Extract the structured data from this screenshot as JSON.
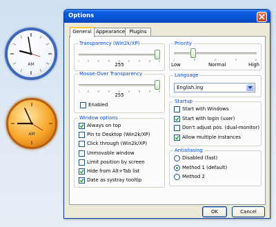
{
  "clocks": {
    "am_label": "AM"
  },
  "window": {
    "title": "Options",
    "tabs": [
      {
        "label": "General",
        "active": true
      },
      {
        "label": "Appearance",
        "active": false
      },
      {
        "label": "Plugins",
        "active": false
      }
    ],
    "transparency": {
      "title": "Transparency (Win2k/XP)",
      "value": "255",
      "level": 1.0
    },
    "mouseover": {
      "title": "Mouse-Over Transparency",
      "value": "255",
      "level": 1.0,
      "enabled_label": "Enabled",
      "enabled_checked": false
    },
    "window_options": {
      "title": "Window options",
      "items": [
        {
          "label": "Always on top",
          "checked": true
        },
        {
          "label": "Pin to Desktop (Win2k/XP)",
          "checked": false
        },
        {
          "label": "Click through (Win2k/XP)",
          "checked": false
        },
        {
          "label": "Unmovable window",
          "checked": false
        },
        {
          "label": "Limit position by screen",
          "checked": false
        },
        {
          "label": "Hide from Alt+Tab list",
          "checked": true
        },
        {
          "label": "Date as systray tooltip",
          "checked": true
        }
      ]
    },
    "priority": {
      "title": "Priority",
      "low": "Low",
      "normal": "Normal",
      "high": "High",
      "level": 0.2
    },
    "language": {
      "title": "Language",
      "selected": "English.ing"
    },
    "startup": {
      "title": "Startup",
      "items": [
        {
          "label": "Start with Windows",
          "checked": false
        },
        {
          "label": "Start with login (user)",
          "checked": true
        },
        {
          "label": "Don't adjust pos. (dual-monitor)",
          "checked": false
        },
        {
          "label": "Allow multiple instances",
          "checked": true
        }
      ]
    },
    "antialiasing": {
      "title": "Antialiasing",
      "items": [
        {
          "label": "Disabled (fast)",
          "selected": false
        },
        {
          "label": "Method 1 (default)",
          "selected": true
        },
        {
          "label": "Method 2",
          "selected": false
        }
      ]
    },
    "buttons": {
      "ok": "OK",
      "cancel": "Cancel"
    }
  }
}
